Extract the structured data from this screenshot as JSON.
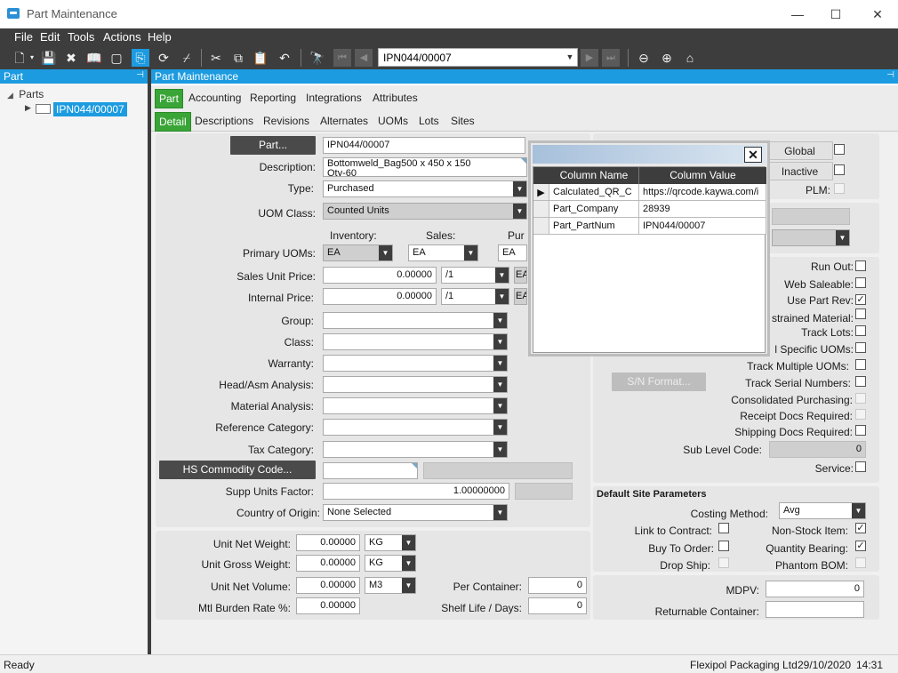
{
  "window": {
    "title": "Part Maintenance"
  },
  "menu": [
    "File",
    "Edit",
    "Tools",
    "Actions",
    "Help"
  ],
  "toolbar": {
    "record": "IPN044/00007"
  },
  "left_panel": {
    "header": "Part",
    "tree_root": "Parts",
    "tree_item": "IPN044/00007"
  },
  "main": {
    "header": "Part Maintenance",
    "tabs_top": [
      "Part",
      "Accounting",
      "Reporting",
      "Integrations",
      "Attributes"
    ],
    "tabs_sub": [
      "Detail",
      "Descriptions",
      "Revisions",
      "Alternates",
      "UOMs",
      "Lots",
      "Sites"
    ]
  },
  "form": {
    "part_button": "Part...",
    "part_value": "IPN044/00007",
    "description_label": "Description:",
    "description_value": "Bottomweld_Bag500 x 450 x 150",
    "description_value2": "Qty-60",
    "type_label": "Type:",
    "type_value": "Purchased",
    "uom_class_label": "UOM Class:",
    "uom_class_value": "Counted Units",
    "inventory_label": "Inventory:",
    "sales_label": "Sales:",
    "purchasing_label": "Pur",
    "primary_uoms_label": "Primary UOMs:",
    "inv_uom": "EA",
    "sales_uom": "EA",
    "pur_uom": "EA",
    "sales_unit_price_label": "Sales Unit Price:",
    "sales_unit_price": "0.00000",
    "sales_per": "/1",
    "sales_price_uom": "EA",
    "internal_price_label": "Internal Price:",
    "internal_price": "0.00000",
    "internal_per": "/1",
    "internal_price_uom": "EA",
    "group_label": "Group:",
    "class_label": "Class:",
    "warranty_label": "Warranty:",
    "head_asm_label": "Head/Asm Analysis:",
    "material_analysis_label": "Material Analysis:",
    "reference_category_label": "Reference Category:",
    "tax_category_label": "Tax Category:",
    "hs_button": "HS Commodity Code...",
    "supp_units_factor_label": "Supp Units Factor:",
    "supp_units_factor": "1.00000000",
    "country_label": "Country of Origin:",
    "country_value": "None Selected",
    "unit_net_weight_label": "Unit Net Weight:",
    "unit_net_weight": "0.00000",
    "unit_net_weight_uom": "KG",
    "unit_gross_weight_label": "Unit Gross Weight:",
    "unit_gross_weight": "0.00000",
    "unit_gross_weight_uom": "KG",
    "unit_net_volume_label": "Unit Net Volume:",
    "unit_net_volume": "0.00000",
    "unit_net_volume_uom": "M3",
    "mtl_burden_label": "Mtl Burden Rate %:",
    "mtl_burden": "0.00000",
    "per_container_label": "Per Container:",
    "per_container": "0",
    "shelf_life_label": "Shelf Life / Days:",
    "shelf_life": "0"
  },
  "right": {
    "global_button": "Global",
    "inactive_button": "Inactive",
    "plm_label": "PLM:",
    "run_out_label": "Run Out:",
    "web_saleable_label": "Web Saleable:",
    "use_part_rev_label": "Use Part Rev:",
    "constrained_material_label": "strained Material:",
    "track_lots_label": "Track Lots:",
    "specific_uoms_label": "l Specific UOMs:",
    "track_multiple_uoms_label": "Track Multiple UOMs:",
    "track_serial_label": "Track Serial Numbers:",
    "sn_format_button": "S/N Format...",
    "consolidated_label": "Consolidated Purchasing:",
    "receipt_docs_label": "Receipt Docs Required:",
    "shipping_docs_label": "Shipping Docs Required:",
    "sub_level_code_label": "Sub Level Code:",
    "sub_level_code": "0",
    "service_label": "Service:",
    "default_site_header": "Default Site Parameters",
    "costing_method_label": "Costing Method:",
    "costing_method": "Avg",
    "link_to_contract_label": "Link to Contract:",
    "non_stock_label": "Non-Stock Item:",
    "buy_to_order_label": "Buy To Order:",
    "quantity_bearing_label": "Quantity Bearing:",
    "drop_ship_label": "Drop Ship:",
    "phantom_bom_label": "Phantom BOM:",
    "mdpv_label": "MDPV:",
    "mdpv": "0",
    "returnable_container_label": "Returnable Container:"
  },
  "checks": {
    "run_out": false,
    "web_saleable": false,
    "use_part_rev": true,
    "constrained": false,
    "track_lots": false,
    "specific_uoms": false,
    "track_multiple_uoms": false,
    "track_serial": false,
    "shipping_docs": false,
    "service": false,
    "link_to_contract": false,
    "non_stock": true,
    "buy_to_order": false,
    "quantity_bearing": true,
    "global": false,
    "inactive": false
  },
  "popup": {
    "close": "✕",
    "columns": [
      "Column Name",
      "Column Value"
    ],
    "rows": [
      [
        "Calculated_QR_C",
        "https://qrcode.kaywa.com/i"
      ],
      [
        "Part_Company",
        "28939"
      ],
      [
        "Part_PartNum",
        "IPN044/00007"
      ]
    ]
  },
  "status": {
    "left": "Ready",
    "company": "Flexipol Packaging Ltd",
    "date": "29/10/2020",
    "time": "14:31"
  }
}
